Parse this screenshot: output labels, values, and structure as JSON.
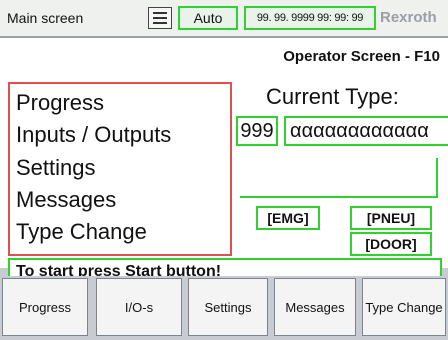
{
  "header": {
    "title": "Main screen",
    "mode": "Auto",
    "clock": "99. 99. 9999 99: 99: 99",
    "brand": "Rexroth"
  },
  "main": {
    "operator_title": "Operator Screen - F10",
    "nav": [
      {
        "label": "Progress"
      },
      {
        "label": "Inputs / Outputs"
      },
      {
        "label": "Settings"
      },
      {
        "label": "Messages"
      },
      {
        "label": "Type Change"
      }
    ],
    "current_type_label": "Current Type:",
    "type_number": "999",
    "type_name": "αααααααααααα",
    "flags": {
      "emg": "[EMG]",
      "pneu": "[PNEU]",
      "door": "[DOOR]"
    },
    "status_message": "To start press Start button!"
  },
  "buttons": [
    {
      "label": "Progress"
    },
    {
      "label": "I/O-s"
    },
    {
      "label": "Settings"
    },
    {
      "label": "Messages"
    },
    {
      "label": "Type Change"
    }
  ],
  "colors": {
    "accent": "#2fd22f",
    "nav_border": "#e05050",
    "brand": "#9a9ea6"
  }
}
